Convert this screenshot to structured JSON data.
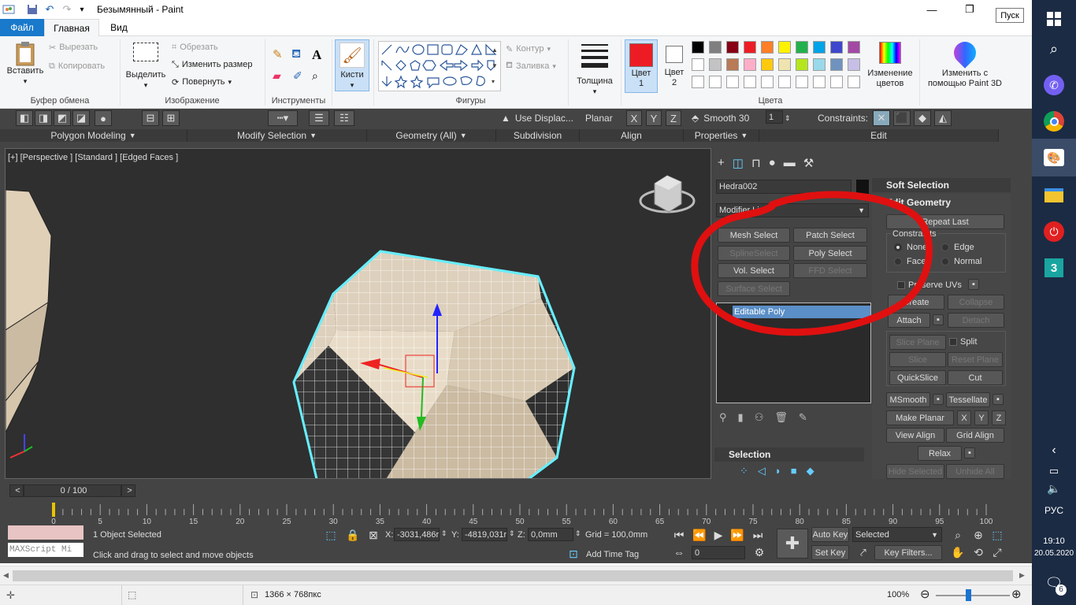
{
  "paint": {
    "title": "Безымянный - Paint",
    "tabs": [
      "Файл",
      "Главная",
      "Вид"
    ],
    "tooltip": "Пуск",
    "groups": {
      "clipboard": {
        "label": "Буфер обмена",
        "paste": "Вставить",
        "cut": "Вырезать",
        "copy": "Копировать"
      },
      "image": {
        "label": "Изображение",
        "select": "Выделить",
        "crop": "Обрезать",
        "resize": "Изменить размер",
        "rotate": "Повернуть"
      },
      "tools": {
        "label": "Инструменты"
      },
      "brushes": {
        "label": "Кисти"
      },
      "shapes": {
        "label": "Фигуры",
        "outline": "Контур",
        "fill": "Заливка"
      },
      "thickness": {
        "label": "Толщина"
      },
      "colors": {
        "label": "Цвета",
        "color1": "Цвет\n1",
        "color1_a": "Цвет",
        "color1_b": "1",
        "color2_a": "Цвет",
        "color2_b": "2",
        "edit": "Изменение",
        "edit2": "цветов"
      },
      "paint3d": {
        "label_a": "Изменить с",
        "label_b": "помощью Paint 3D"
      }
    },
    "color1_value": "#ed1c24",
    "color2_value": "#ffffff",
    "palette_row1": [
      "#000000",
      "#7f7f7f",
      "#880015",
      "#ed1c24",
      "#ff7f27",
      "#fff200",
      "#22b14c",
      "#00a2e8",
      "#3f48cc",
      "#a349a4"
    ],
    "palette_row2": [
      "#ffffff",
      "#c3c3c3",
      "#b97a57",
      "#ffaec9",
      "#ffc90e",
      "#efe4b0",
      "#b5e61d",
      "#99d9ea",
      "#7092be",
      "#c8bfe7"
    ],
    "status": {
      "dimensions": "1366 × 768пкс",
      "zoom": "100%"
    }
  },
  "max": {
    "ribbon": {
      "panels": [
        "Polygon Modeling",
        "Modify Selection",
        "Geometry (All)",
        "Subdivision",
        "Align",
        "Properties",
        "Edit"
      ],
      "use_displace": "Use Displac...",
      "planar": "Planar",
      "x": "X",
      "y": "Y",
      "z": "Z",
      "smooth": "Smooth 30",
      "smooth_val": "1",
      "constraints": "Constraints:"
    },
    "viewport_label": "[+] [Perspective ] [Standard ] [Edged Faces ]",
    "cmd": {
      "object_name": "Hedra002",
      "modifier_list": "Modifier List",
      "buttons": [
        "Mesh Select",
        "Patch Select",
        "SplineSelect",
        "Poly Select",
        "Vol. Select",
        "FFD Select",
        "Surface Select"
      ],
      "stack_item": "Editable Poly",
      "selection": "Selection"
    },
    "rollout": {
      "soft_selection": "Soft Selection",
      "edit_geometry": "Edit Geometry",
      "repeat_last": "Repeat Last",
      "constraints": "Constraints",
      "none": "None",
      "edge": "Edge",
      "face": "Face",
      "normal": "Normal",
      "preserve_uvs": "Preserve UVs",
      "create": "Create",
      "collapse": "Collapse",
      "attach": "Attach",
      "detach": "Detach",
      "slice_plane": "Slice Plane",
      "split": "Split",
      "slice": "Slice",
      "reset_plane": "Reset Plane",
      "quickslice": "QuickSlice",
      "cut": "Cut",
      "msmooth": "MSmooth",
      "tessellate": "Tessellate",
      "make_planar": "Make Planar",
      "x": "X",
      "y": "Y",
      "z": "Z",
      "view_align": "View Align",
      "grid_align": "Grid Align",
      "relax": "Relax",
      "hide_selected": "Hide Selected",
      "unhide_all": "Unhide All"
    },
    "timeline": {
      "frame": "0 / 100",
      "ticks": [
        "0",
        "5",
        "10",
        "15",
        "20",
        "25",
        "30",
        "35",
        "40",
        "45",
        "50",
        "55",
        "60",
        "65",
        "70",
        "75",
        "80",
        "85",
        "90",
        "95",
        "100"
      ]
    },
    "status": {
      "maxscript": "MAXScript Mi",
      "selected": "1 Object Selected",
      "prompt": "Click and drag to select and move objects",
      "x_label": "X:",
      "x": "-3031,486r",
      "y_label": "Y:",
      "y": "-4819,031r",
      "z_label": "Z:",
      "z": "0,0mm",
      "grid": "Grid = 100,0mm",
      "add_time_tag": "Add Time Tag",
      "auto_key": "Auto Key",
      "set_key": "Set Key",
      "selected_dd": "Selected",
      "key_filters": "Key Filters...",
      "frame_field": "0"
    }
  },
  "taskbar": {
    "time": "19:10",
    "date": "20.05.2020",
    "lang": "РУС",
    "notifications": "6"
  }
}
